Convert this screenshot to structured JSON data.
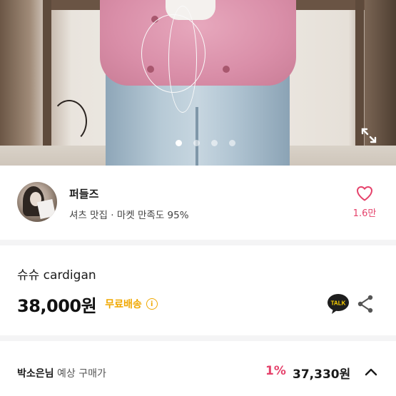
{
  "gallery": {
    "dot_count": 4,
    "active_index": 0,
    "expand_icon": "expand-icon"
  },
  "seller": {
    "name": "퍼들즈",
    "meta": "셔츠 맛집 · 마켓 만족도 95%",
    "likes": "1.6만",
    "like_icon": "heart-outline-icon"
  },
  "product": {
    "title": "슈슈 cardigan",
    "price": "38,000원",
    "shipping_badge": "무료배송",
    "info_icon": "info-icon",
    "talk_icon": "kakao-talk-icon",
    "talk_label": "TALK",
    "share_icon": "share-icon"
  },
  "buyer_estimate": {
    "buyer_name": "박소은님",
    "label_suffix": " 예상 구매가",
    "discount": "1%",
    "estimated_price": "37,330원",
    "toggle_icon": "chevron-up-icon"
  },
  "colors": {
    "accent_pink": "#e5426b",
    "shipping_yellow": "#f0a800",
    "divider": "#f4f4f5",
    "talk_bg": "#1e1e1e",
    "talk_text": "#ffd400"
  }
}
